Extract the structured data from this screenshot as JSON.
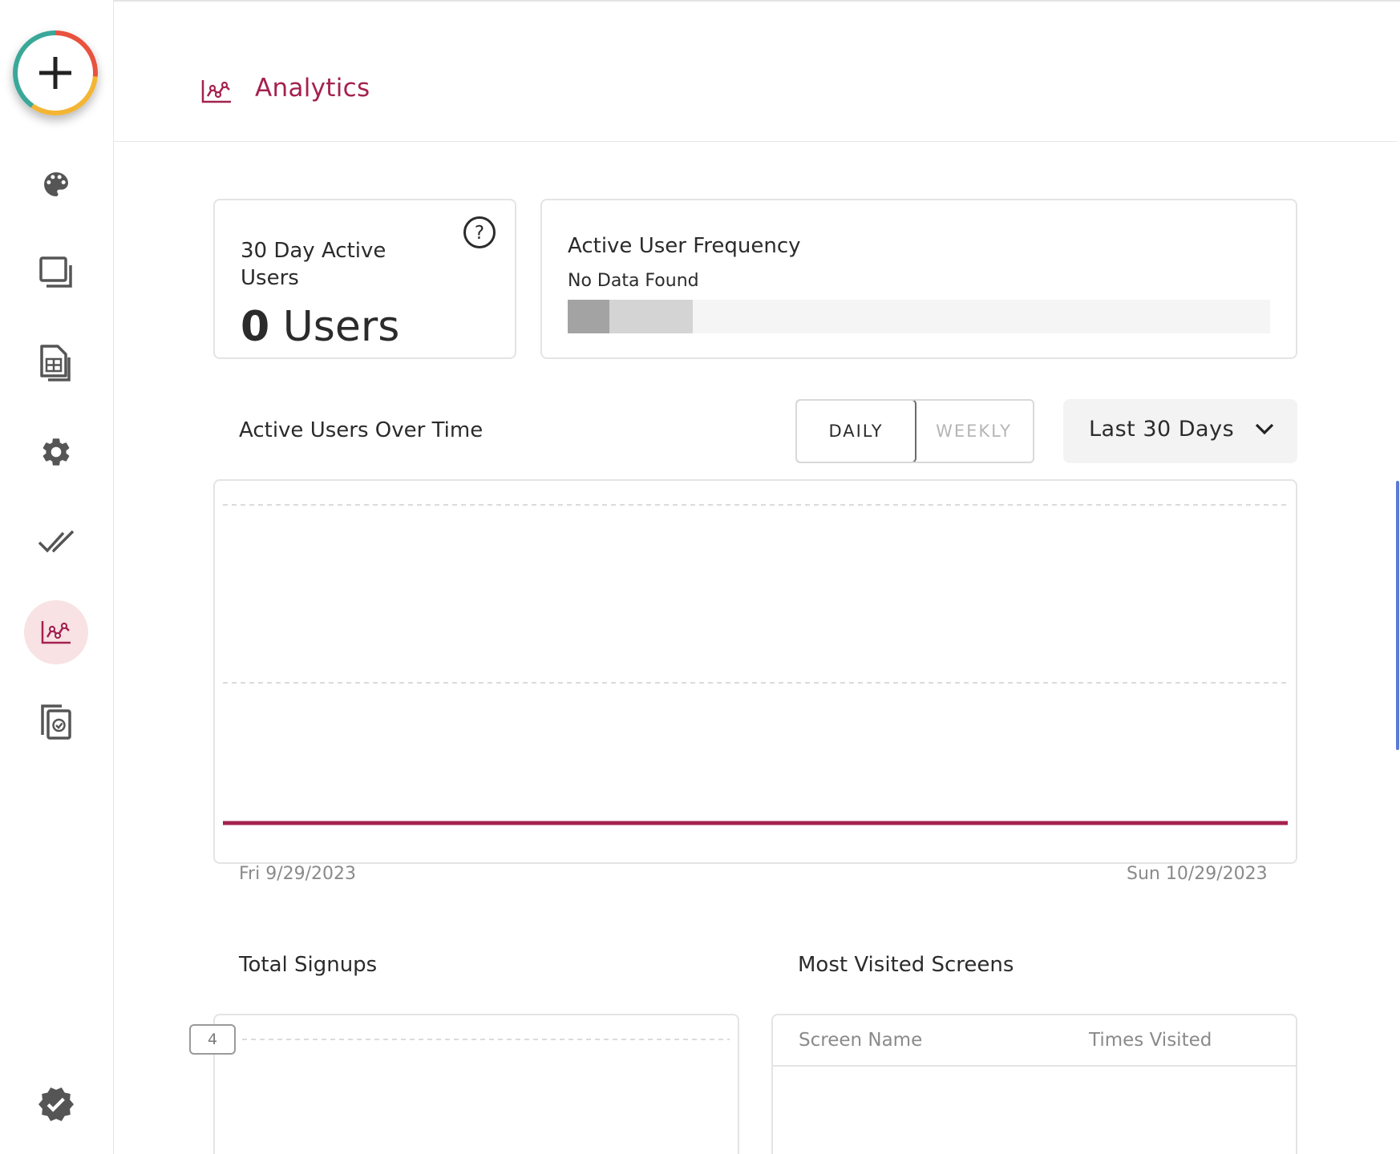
{
  "header": {
    "title": "Analytics",
    "icon": "analytics-icon"
  },
  "sidebar": {
    "add_button_icon": "plus-icon",
    "items": [
      {
        "id": "theme",
        "icon": "palette-icon"
      },
      {
        "id": "screens",
        "icon": "screens-icon"
      },
      {
        "id": "data",
        "icon": "spreadsheet-icon"
      },
      {
        "id": "settings",
        "icon": "gear-icon"
      },
      {
        "id": "tasks",
        "icon": "double-check-icon"
      },
      {
        "id": "analytics",
        "icon": "analytics-icon",
        "active": true
      },
      {
        "id": "publish",
        "icon": "copy-check-icon"
      }
    ],
    "footer_icon": "verified-badge-icon"
  },
  "dau_card": {
    "title": "30 Day Active Users",
    "count": "0",
    "unit": "Users"
  },
  "frequency_card": {
    "title": "Active User Frequency",
    "status": "No Data Found",
    "segment_colors": [
      "#a3a3a3",
      "#d4d4d4",
      "#f5f5f5"
    ]
  },
  "active_users": {
    "title": "Active Users Over Time",
    "toggle": {
      "daily": "DAILY",
      "weekly": "WEEKLY",
      "selected": "daily"
    },
    "range": {
      "selected": "Last 30 Days"
    }
  },
  "chart_data": {
    "type": "line",
    "x_start": "Fri 9/29/2023",
    "x_end": "Sun 10/29/2023",
    "series": [
      {
        "color": "#a5214f",
        "values": [
          0,
          0
        ]
      }
    ],
    "grid": true
  },
  "signups": {
    "title": "Total Signups",
    "tick": "4"
  },
  "screens": {
    "title": "Most Visited Screens",
    "columns": [
      "Screen Name",
      "Times Visited"
    ],
    "rows": []
  },
  "colors": {
    "accent": "#a5214f",
    "active_bg": "#f8e2e3",
    "icon": "#555555"
  }
}
